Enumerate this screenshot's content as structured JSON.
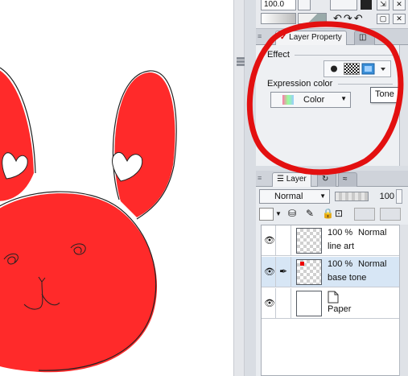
{
  "toolbar": {
    "value": "100.0"
  },
  "layer_property": {
    "tab_label": "Layer Property",
    "effect_label": "Effect",
    "expression_color_label": "Expression color",
    "expression_color_value": "Color",
    "tooltip": "Tone"
  },
  "layer_panel": {
    "tab_label": "Layer",
    "blend_mode": "Normal",
    "opacity": "100",
    "layers": [
      {
        "percent": "100 %",
        "mode": "Normal",
        "name": "line art",
        "selected": false
      },
      {
        "percent": "100 %",
        "mode": "Normal",
        "name": "base tone",
        "selected": true
      },
      {
        "percent": "",
        "mode": "",
        "name": "Paper",
        "selected": false
      }
    ]
  },
  "colors": {
    "bunny_fill": "#ff2a2a",
    "annotation_circle": "#e31010",
    "panel_bg": "#d9dde3",
    "selected_row": "#d7e6f5",
    "tone_effect_active": "#3a8fd8"
  },
  "icons": [
    "eye-icon",
    "pen-icon",
    "paper-icon",
    "layer-stack-icon",
    "circle-effect-icon",
    "checker-tone-icon",
    "color-swatch-icon",
    "dropdown-arrow-icon"
  ]
}
